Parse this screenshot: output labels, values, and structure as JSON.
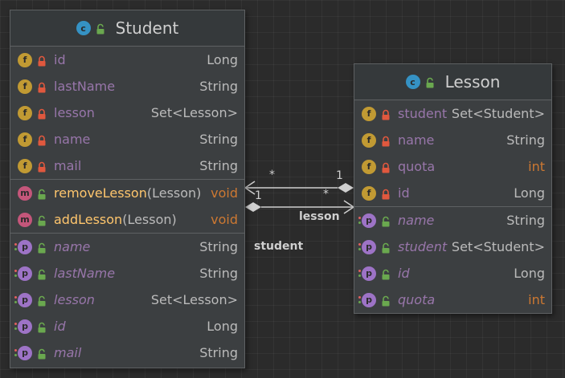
{
  "student": {
    "title": "Student",
    "fields": [
      {
        "name": "id",
        "type": "Long"
      },
      {
        "name": "lastName",
        "type": "String"
      },
      {
        "name": "lesson",
        "type": "Set<Lesson>"
      },
      {
        "name": "name",
        "type": "String"
      },
      {
        "name": "mail",
        "type": "String"
      }
    ],
    "methods": [
      {
        "name": "removeLesson",
        "params": "(Lesson)",
        "type": "void"
      },
      {
        "name": "addLesson",
        "params": "(Lesson)",
        "type": "void"
      }
    ],
    "properties": [
      {
        "name": "name",
        "type": "String"
      },
      {
        "name": "lastName",
        "type": "String"
      },
      {
        "name": "lesson",
        "type": "Set<Lesson>"
      },
      {
        "name": "id",
        "type": "Long"
      },
      {
        "name": "mail",
        "type": "String"
      }
    ]
  },
  "lesson": {
    "title": "Lesson",
    "fields": [
      {
        "name": "student",
        "type": "Set<Student>"
      },
      {
        "name": "name",
        "type": "String"
      },
      {
        "name": "quota",
        "type": "int"
      },
      {
        "name": "id",
        "type": "Long"
      }
    ],
    "properties": [
      {
        "name": "name",
        "type": "String"
      },
      {
        "name": "student",
        "type": "Set<Student>"
      },
      {
        "name": "id",
        "type": "Long"
      },
      {
        "name": "quota",
        "type": "int"
      }
    ]
  },
  "badges": {
    "class": "c",
    "field": "f",
    "method": "m",
    "property": "p"
  },
  "associations": {
    "lesson_label": "lesson",
    "student_label": "student",
    "upper_left_mult": "*",
    "upper_right_mult": "1",
    "lower_left_mult": "1",
    "lower_right_mult": "*"
  },
  "colors": {
    "background": "#2b2b2b",
    "node": "#3c3f41",
    "field_name": "#9876aa",
    "method_name": "#ffc66d",
    "keyword": "#cc7832",
    "class_badge": "#3592c4",
    "field_badge": "#c19a33",
    "method_badge": "#c4567a",
    "property_badge": "#9d73c6"
  }
}
